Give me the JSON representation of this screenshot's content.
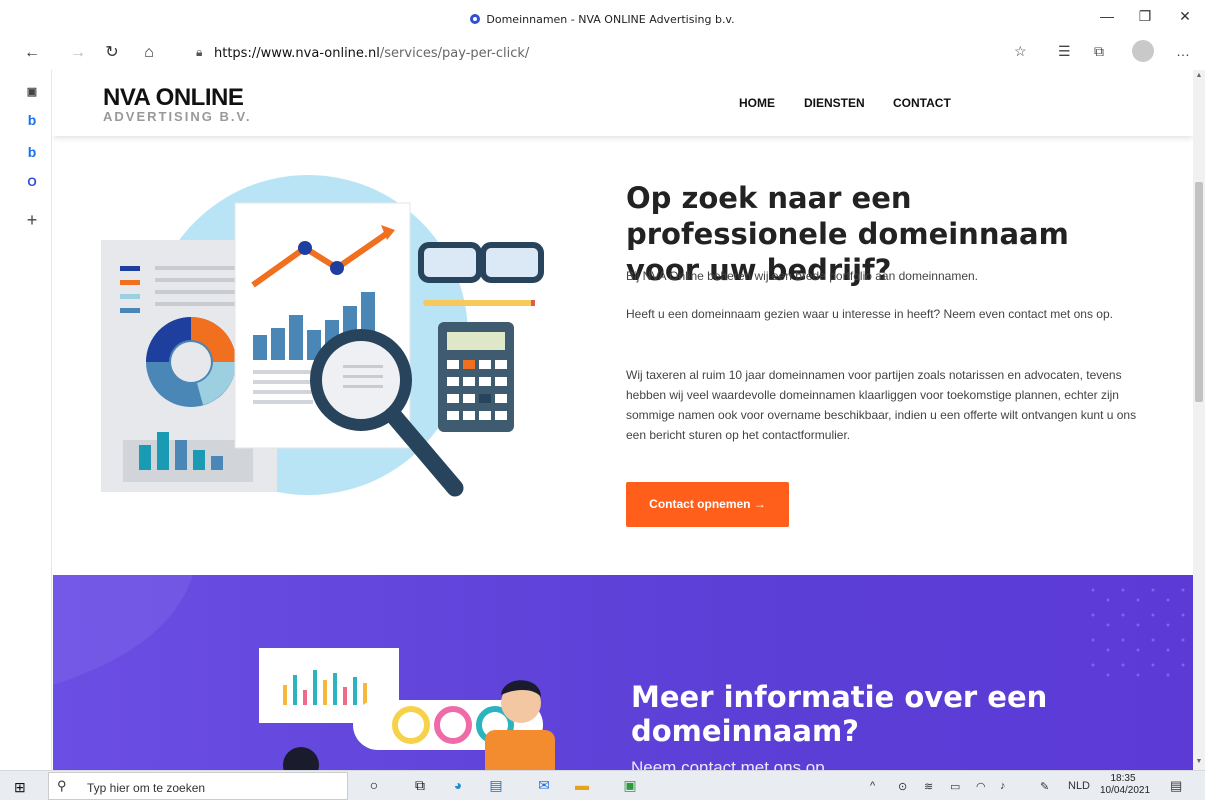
{
  "window": {
    "title": "Domeinnamen - NVA ONLINE Advertising b.v."
  },
  "browser": {
    "url_host": "https://www.nva-online.nl",
    "url_path": "/services/pay-per-click/"
  },
  "site": {
    "logo_main": "NVA ONLINE",
    "logo_sub": "ADVERTISING B.V.",
    "menu": [
      "HOME",
      "DIENSTEN",
      "CONTACT"
    ]
  },
  "hero": {
    "title": "Op zoek naar een professionele domeinnaam voor uw bedrijf?",
    "p1": "Bij NVA Online beheren wij een brede portfolio aan domeinnamen.",
    "p2": "Heeft u een domeinnaam gezien waar u interesse in heeft? Neem even contact met ons op.",
    "p3": "Wij taxeren al ruim 10 jaar domeinnamen voor partijen zoals notarissen en advocaten, tevens hebben wij veel waardevolle domeinnamen klaarliggen voor toekomstige plannen, echter zijn sommige namen ook voor overname beschikbaar, indien u een offerte wilt ontvangen kunt u ons een bericht sturen op het contactformulier.",
    "cta": "Contact opnemen →"
  },
  "info": {
    "title": "Meer informatie over een domeinnaam?",
    "subtitle": "Neem contact met ons op"
  },
  "taskbar": {
    "search_placeholder": "Typ hier om te zoeken",
    "language": "NLD",
    "time": "18:35",
    "date": "10/04/2021"
  },
  "colors": {
    "accent": "#ff5f1a",
    "purple": "#5b3fd6",
    "favicon": "#2f4fd6"
  }
}
